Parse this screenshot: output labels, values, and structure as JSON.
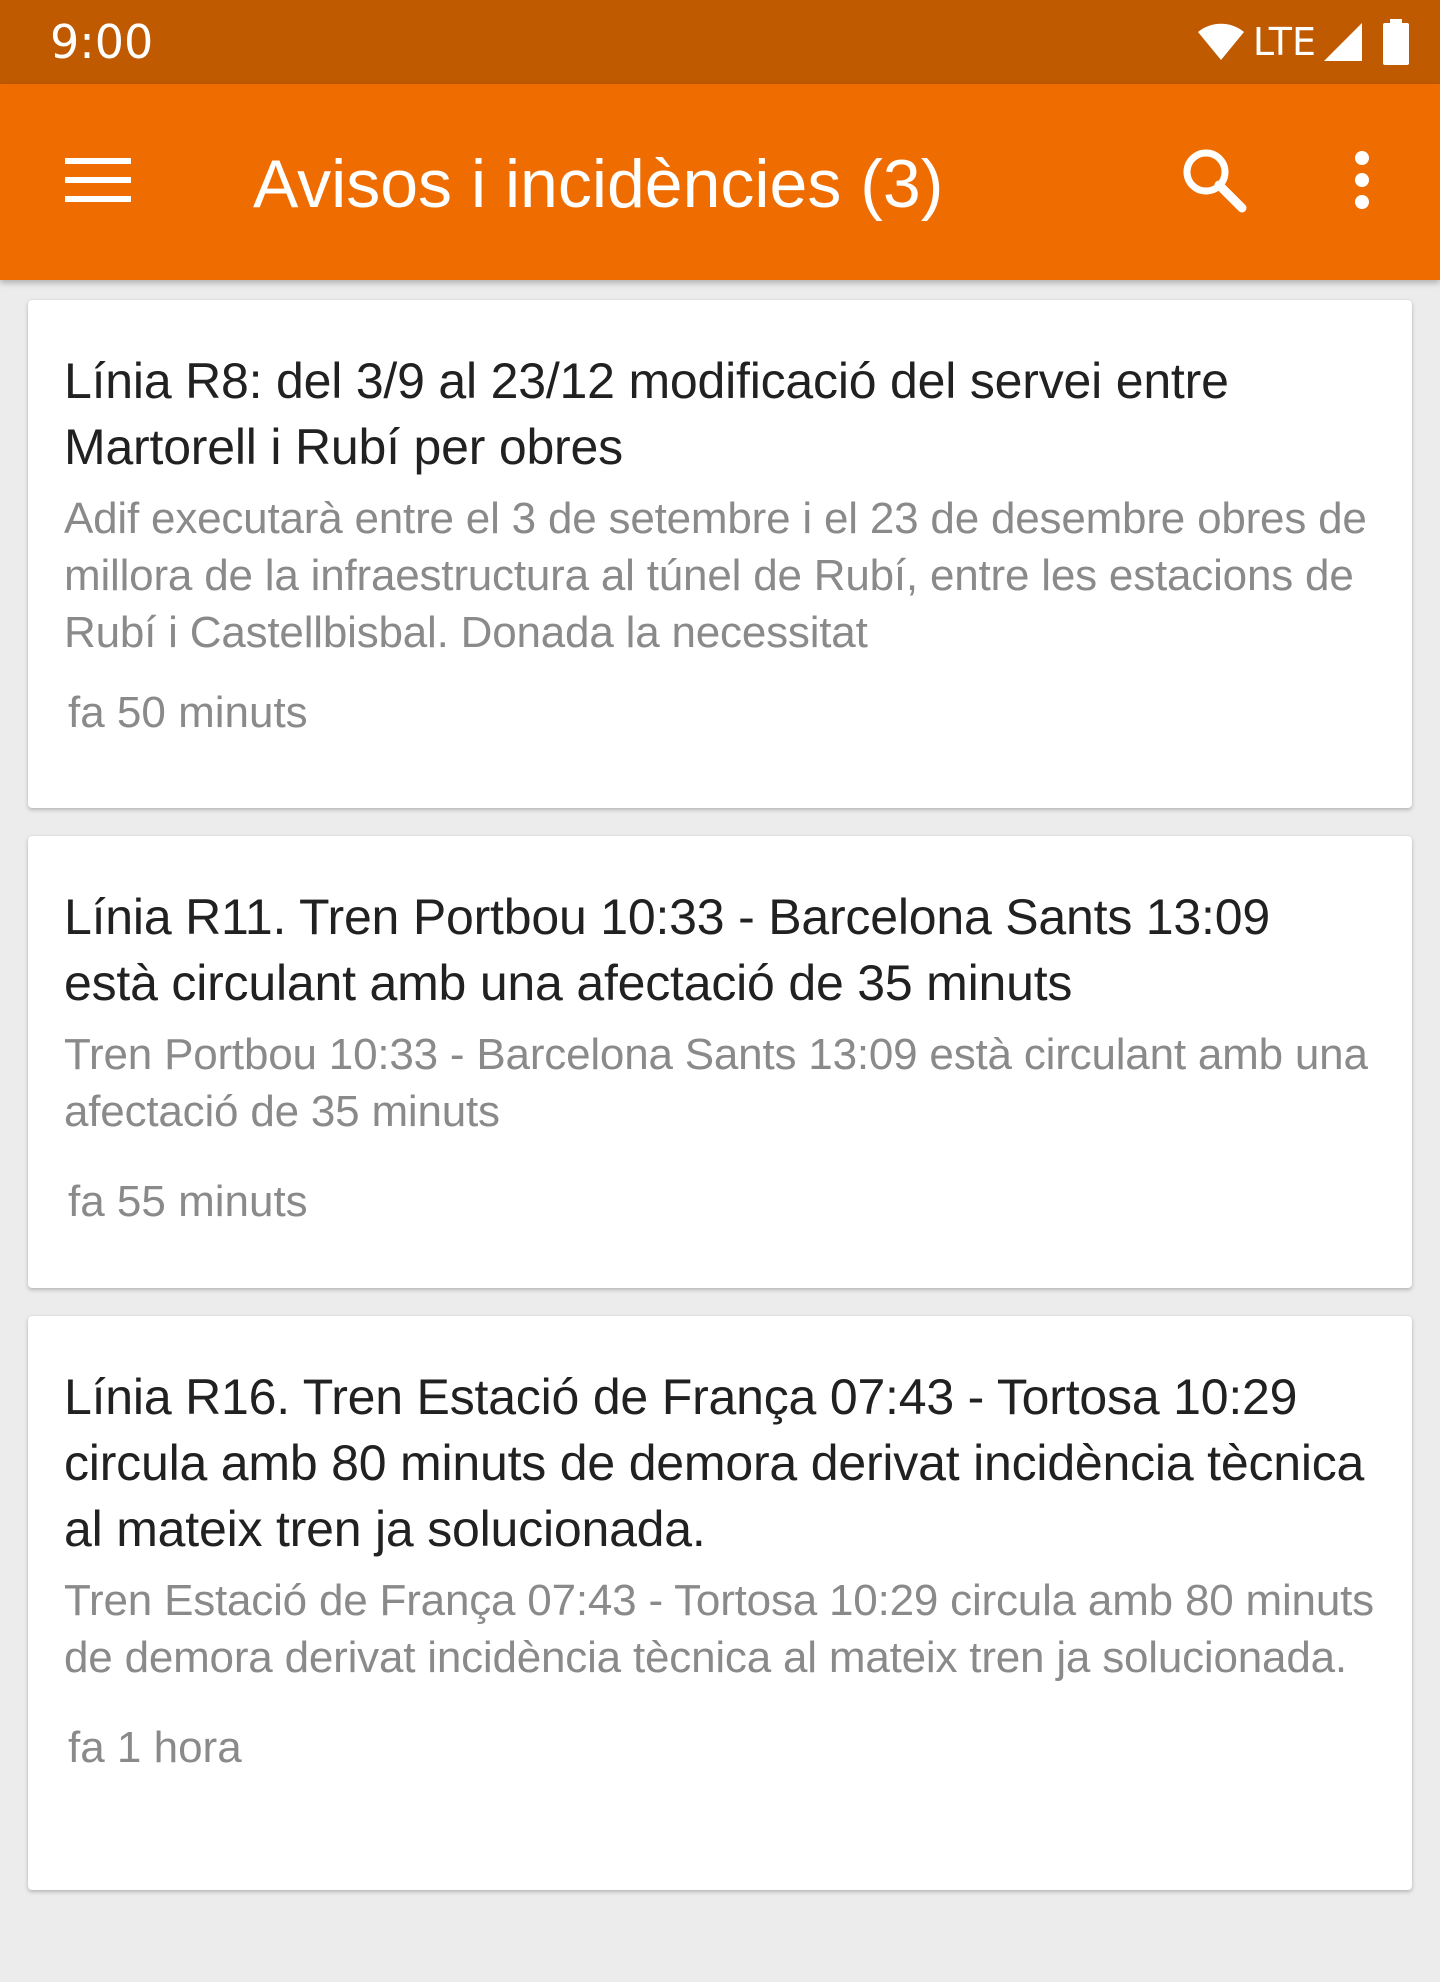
{
  "status_bar": {
    "time": "9:00",
    "network": "LTE",
    "icons": [
      "wifi-icon",
      "cell-signal-icon",
      "battery-icon"
    ]
  },
  "app_bar": {
    "title": "Avisos i incidències (3)",
    "background_color": "#ef6c00",
    "status_color": "#bf5a00",
    "icons": [
      "menu-icon",
      "search-icon",
      "more-vert-icon"
    ]
  },
  "notices": [
    {
      "title": "Línia R8: del 3/9 al 23/12 modificació del servei entre Martorell i Rubí per obres",
      "body": "Adif executarà entre el 3 de setembre i el 23 de desembre obres de millora de la infraestructura al túnel de Rubí, entre les estacions de Rubí i Castellbisbal. Donada la necessitat",
      "time": "fa 50 minuts"
    },
    {
      "title": "Línia R11. Tren Portbou 10:33 - Barcelona Sants 13:09 està circulant amb una afectació de 35 minuts",
      "body": "Tren Portbou 10:33 - Barcelona Sants 13:09 està circulant amb una afectació de 35 minuts",
      "time": "fa 55 minuts"
    },
    {
      "title": "Línia R16. Tren Estació de França 07:43 - Tortosa 10:29 circula amb 80 minuts de demora derivat incidència tècnica al mateix tren ja solucionada.",
      "body": "Tren Estació de França 07:43 - Tortosa 10:29 circula amb 80 minuts de demora derivat incidència tècnica al mateix tren ja solucionada.",
      "time": "fa 1 hora"
    }
  ]
}
